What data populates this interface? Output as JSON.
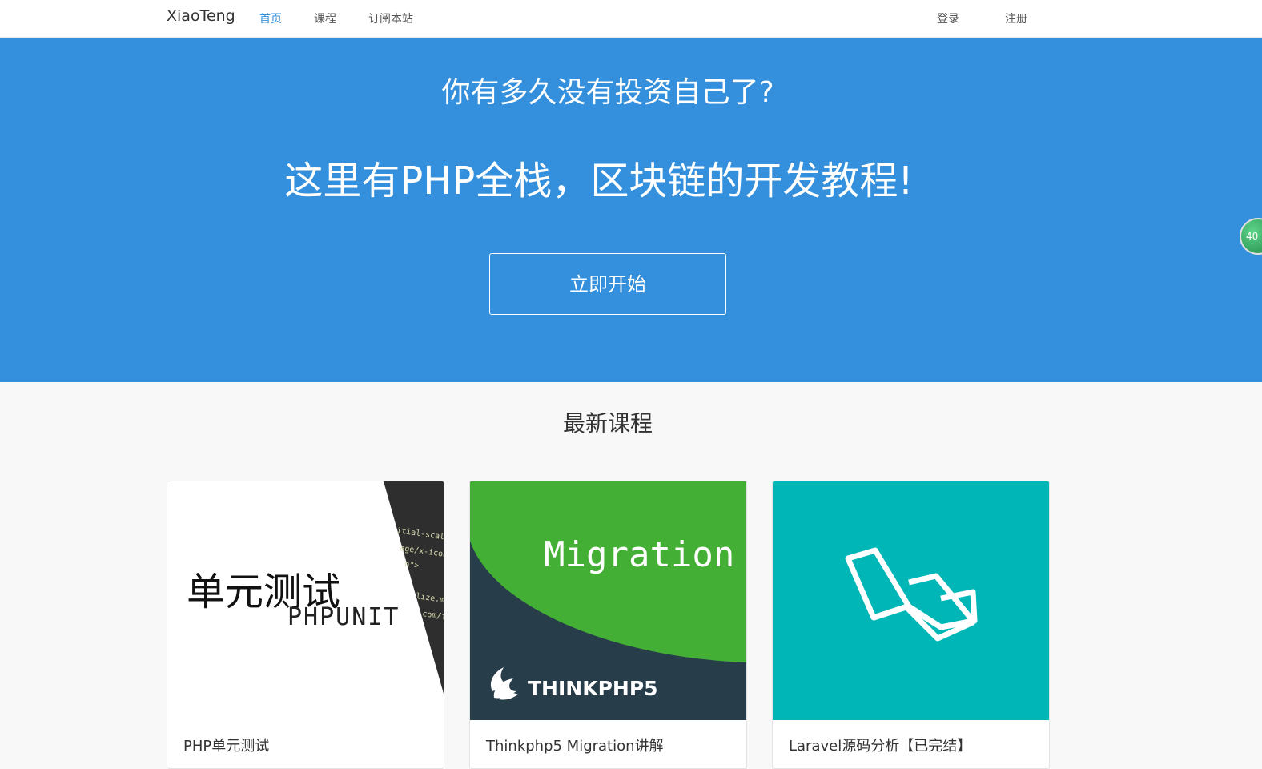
{
  "nav": {
    "brand": "XiaoTeng",
    "links": [
      {
        "label": "首页",
        "active": true
      },
      {
        "label": "课程",
        "active": false
      },
      {
        "label": "订阅本站",
        "active": false
      }
    ],
    "login": "登录",
    "register": "注册"
  },
  "hero": {
    "question": "你有多久没有投资自己了?",
    "headline": "这里有PHP全栈，区块链的开发教程!",
    "cta": "立即开始",
    "background": "#3490dc"
  },
  "floating_badge": "40",
  "section": {
    "title": "最新课程"
  },
  "courses": [
    {
      "title": "PHP单元测试",
      "image": {
        "main_text": "单元测试",
        "sub_text": "PHPUNIT"
      }
    },
    {
      "title": "Thinkphp5 Migration讲解",
      "image": {
        "main_text": "Migration",
        "logo_text": "THINKPHP5"
      }
    },
    {
      "title": "Laravel源码分析【已完结】",
      "image": {
        "icon": "laravel-logo-icon"
      }
    }
  ],
  "colors": {
    "primary": "#3490dc",
    "thinkphp_green": "#44af35",
    "thinkphp_dark": "#283d4a",
    "laravel_teal": "#00b6b7"
  }
}
